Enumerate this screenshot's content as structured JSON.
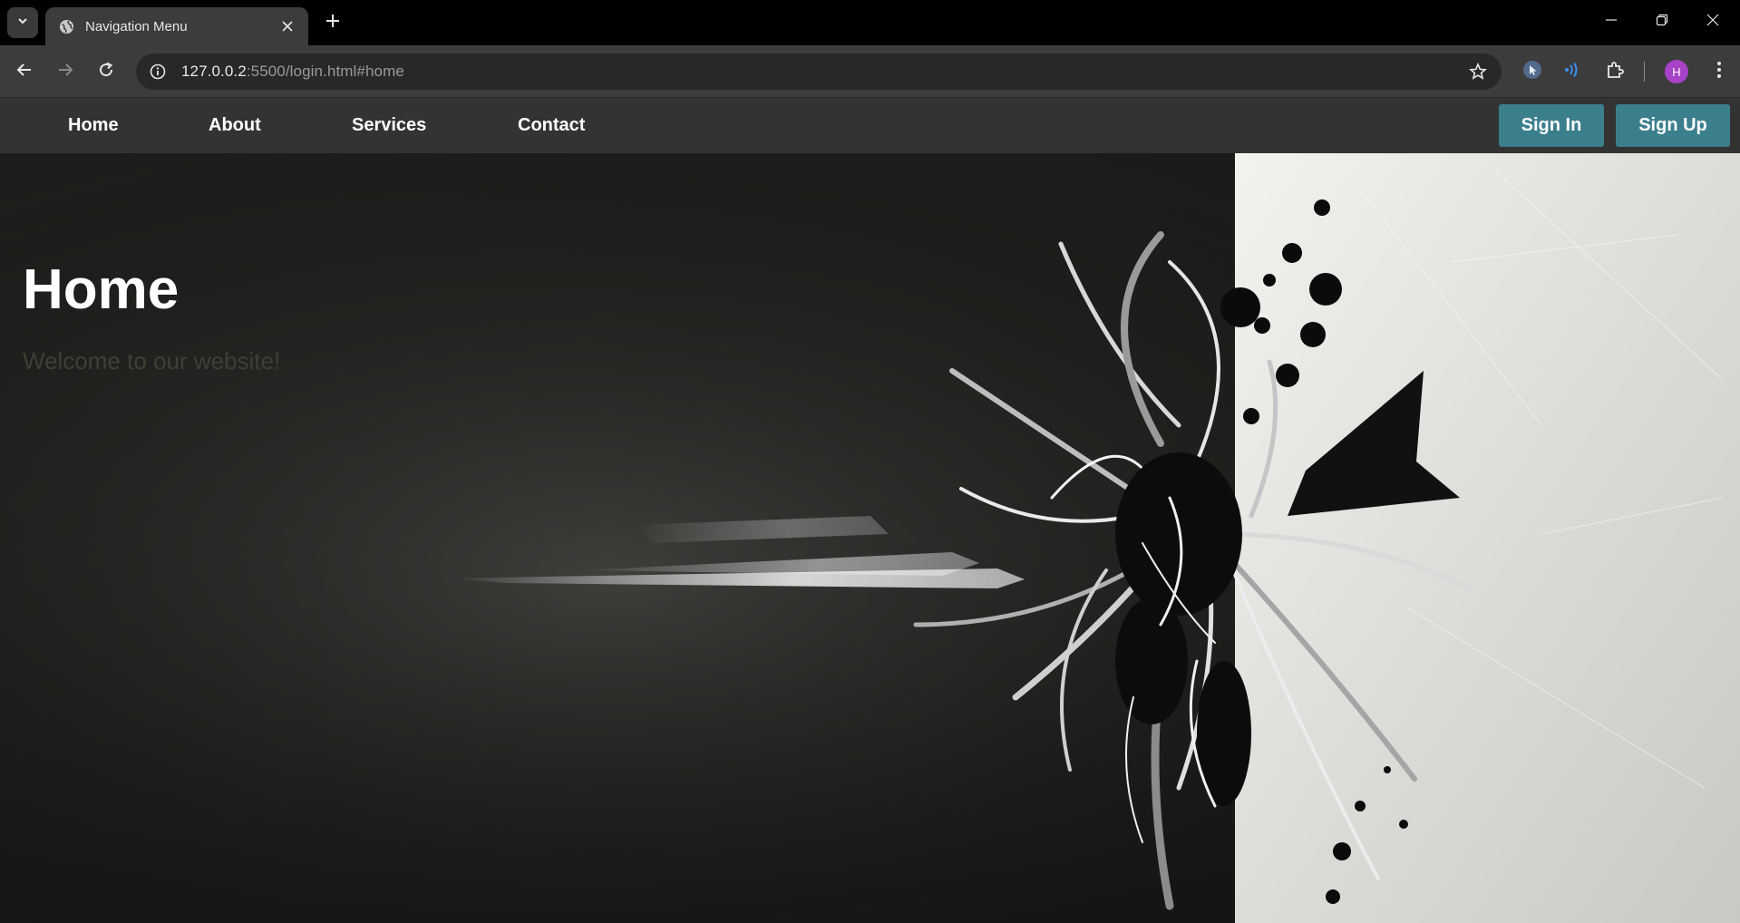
{
  "browser": {
    "tab_title": "Navigation Menu",
    "url_host": "127.0.0.2",
    "url_rest": ":5500/login.html#home",
    "avatar_letter": "H",
    "icons": [
      "tab-search-icon",
      "globe-icon",
      "close-icon",
      "plus-icon",
      "minimize-icon",
      "restore-icon",
      "window-close-icon",
      "back-arrow-icon",
      "forward-arrow-icon",
      "reload-icon",
      "info-icon",
      "star-icon",
      "cursor-extension-icon",
      "audio-extension-icon",
      "puzzle-icon",
      "kebab-menu-icon"
    ]
  },
  "nav": {
    "links": [
      "Home",
      "About",
      "Services",
      "Contact"
    ],
    "sign_in": "Sign In",
    "sign_up": "Sign Up"
  },
  "hero": {
    "title": "Home",
    "subtitle": "Welcome to our website!"
  },
  "colors": {
    "nav_bg": "#333333",
    "button_bg": "#3b7f8d",
    "subtitle": "#3f3f36"
  }
}
